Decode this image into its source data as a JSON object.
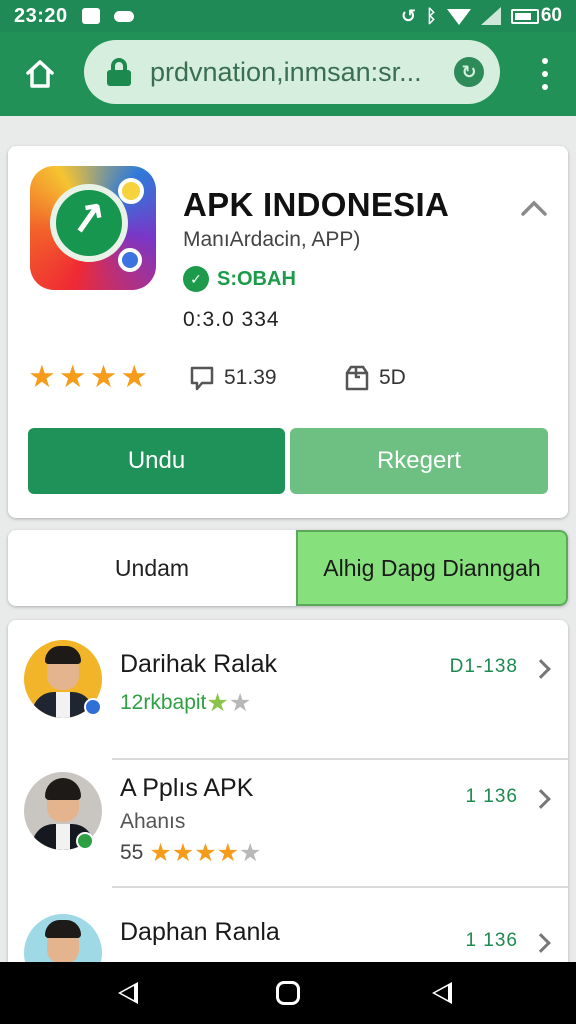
{
  "status_bar": {
    "time": "23:20",
    "battery": "60",
    "icons": [
      "gallery-icon",
      "cloud-icon",
      "sync-icon",
      "bluetooth-icon",
      "wifi-icon",
      "signal-icon",
      "battery-icon"
    ]
  },
  "browser": {
    "url": "prdvnation,inmsan:sr...",
    "reload_glyph": "↻"
  },
  "app": {
    "title": "APK INDONESIA",
    "subtitle": "ManıArdacin, APP)",
    "verified_label": "S:OBAH",
    "verified_glyph": "✓",
    "version": "0:3.0 334",
    "rating": {
      "stars_filled": 4,
      "stars_total": 4
    },
    "reviews_count": "51.39",
    "size": "5D",
    "primary_button": "Undu",
    "secondary_button": "Rkegert"
  },
  "tabs": [
    {
      "label": "Undam",
      "active": false
    },
    {
      "label": "Alhig Dapg Dianngah",
      "active": true
    }
  ],
  "list": [
    {
      "title": "Darihak Ralak",
      "subtitle": "12rkbapit",
      "subtitle_color": "#2ea043",
      "stars_filled": 1,
      "stars_total": 2,
      "number": "D1-138",
      "badge_color": "#2f6fd6"
    },
    {
      "title": "A Pplıs APK",
      "subtitle_line1": "Ahanıs",
      "rating_value": "55",
      "stars_filled": 4,
      "stars_total": 5,
      "number": "1 136",
      "badge_color": "#2ea043"
    },
    {
      "title": "Daphan Ranla",
      "number": "1 136"
    }
  ],
  "colors": {
    "status_bar": "#1f8a55",
    "toolbar": "#219157",
    "primary_button": "#1e9259",
    "secondary_button": "#6dbf82",
    "active_tab": "#86e07c",
    "star": "#f59c1a"
  }
}
